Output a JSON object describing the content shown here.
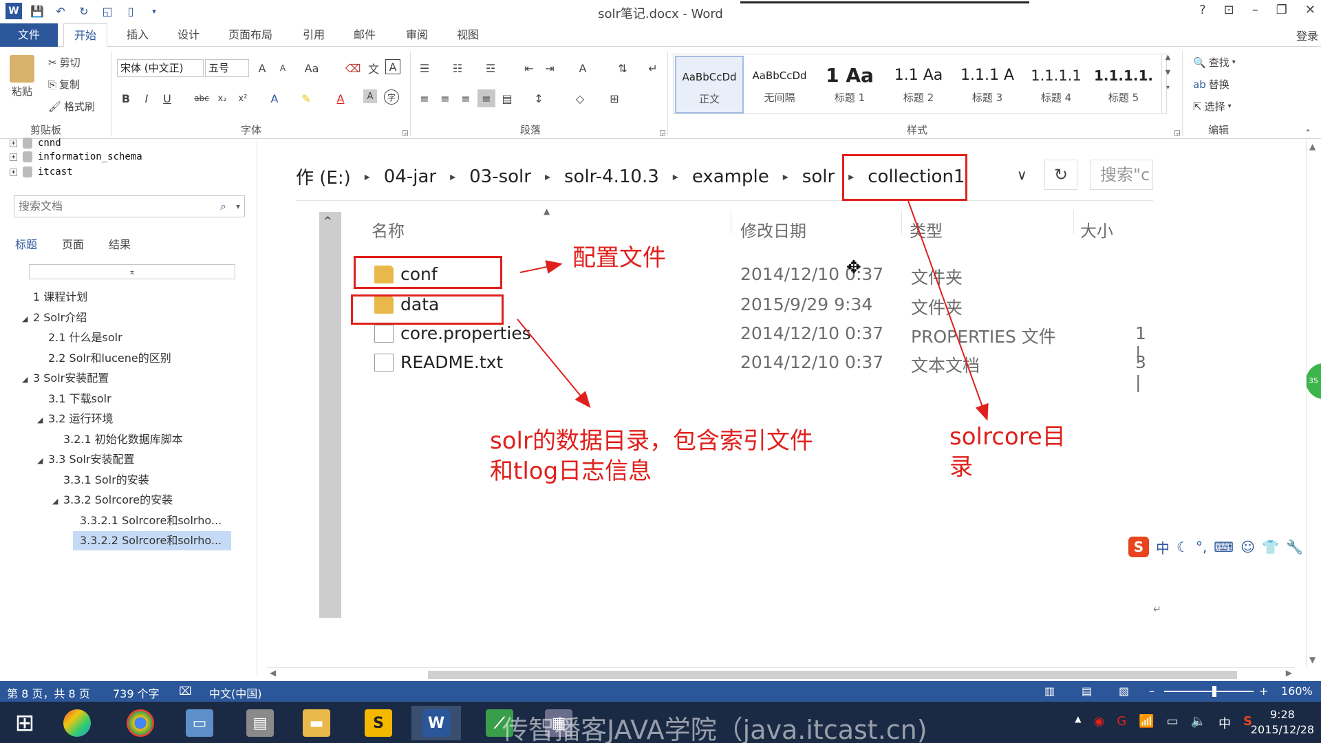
{
  "window": {
    "title": "solr笔记.docx - Word",
    "help": "?",
    "min": "–",
    "restore": "❐",
    "close": "✕"
  },
  "tabs": [
    "文件",
    "开始",
    "插入",
    "设计",
    "页面布局",
    "引用",
    "邮件",
    "审阅",
    "视图"
  ],
  "login": "登录",
  "ribbon": {
    "clipboard": {
      "paste": "粘贴",
      "cut": "剪切",
      "copy": "复制",
      "format_painter": "格式刷",
      "label": "剪贴板"
    },
    "font": {
      "name": "宋体 (中文正)",
      "size": "五号",
      "label": "字体",
      "bold": "B",
      "italic": "I",
      "underline": "U",
      "strike": "abc",
      "sub": "x₂",
      "sup": "x²",
      "case": "Aa",
      "grow": "A",
      "shrink": "A"
    },
    "paragraph": {
      "label": "段落"
    },
    "styles": {
      "label": "样式",
      "items": [
        {
          "sample": "AaBbCcDd",
          "name": "正文"
        },
        {
          "sample": "AaBbCcDd",
          "name": "无间隔"
        },
        {
          "sample": "1 Aa",
          "name": "标题 1"
        },
        {
          "sample": "1.1 Aa",
          "name": "标题 2"
        },
        {
          "sample": "1.1.1 A",
          "name": "标题 3"
        },
        {
          "sample": "1.1.1.1",
          "name": "标题 4"
        },
        {
          "sample": "1.1.1.1.",
          "name": "标题 5"
        }
      ]
    },
    "editing": {
      "find": "查找",
      "replace": "替换",
      "select": "选择",
      "label": "编辑"
    }
  },
  "nav": {
    "db_items": [
      "cnnd",
      "information_schema",
      "itcast"
    ],
    "search_placeholder": "搜索文档",
    "tabs": [
      "标题",
      "页面",
      "结果"
    ],
    "headings": [
      {
        "text": "1 课程计划",
        "level": 1,
        "expand": ""
      },
      {
        "text": "2 Solr介绍",
        "level": 1,
        "expand": "◢"
      },
      {
        "text": "2.1 什么是solr",
        "level": 2,
        "expand": ""
      },
      {
        "text": "2.2 Solr和lucene的区别",
        "level": 2,
        "expand": ""
      },
      {
        "text": "3 Solr安装配置",
        "level": 1,
        "expand": "◢"
      },
      {
        "text": "3.1 下载solr",
        "level": 2,
        "expand": ""
      },
      {
        "text": "3.2 运行环境",
        "level": 2,
        "expand": "◢"
      },
      {
        "text": "3.2.1 初始化数据库脚本",
        "level": 3,
        "expand": ""
      },
      {
        "text": "3.3 Solr安装配置",
        "level": 2,
        "expand": "◢"
      },
      {
        "text": "3.3.1 Solr的安装",
        "level": 3,
        "expand": ""
      },
      {
        "text": "3.3.2 Solrcore的安装",
        "level": 3,
        "expand": "◢"
      },
      {
        "text": "3.3.2.1 Solrcore和solrho...",
        "level": 4,
        "expand": ""
      },
      {
        "text": "3.3.2.2 Solrcore和solrho...",
        "level": 4,
        "expand": "",
        "selected": true
      }
    ]
  },
  "explorer": {
    "breadcrumbs": [
      "作 (E:)",
      "04-jar",
      "03-solr",
      "solr-4.10.3",
      "example",
      "solr",
      "collection1"
    ],
    "search_placeholder": "搜索\"c",
    "columns": {
      "name": "名称",
      "date": "修改日期",
      "type": "类型",
      "size": "大小"
    },
    "files": [
      {
        "name": "conf",
        "date": "2014/12/10 0:37",
        "type": "文件夹",
        "size": "",
        "icon": "folder-icon"
      },
      {
        "name": "data",
        "date": "2015/9/29 9:34",
        "type": "文件夹",
        "size": "",
        "icon": "folder-icon"
      },
      {
        "name": "core.properties",
        "date": "2014/12/10 0:37",
        "type": "PROPERTIES 文件",
        "size": "1 |",
        "icon": "file-icon"
      },
      {
        "name": "README.txt",
        "date": "2014/12/10 0:37",
        "type": "文本文档",
        "size": "3 |",
        "icon": "text-file-icon"
      }
    ]
  },
  "annotations": {
    "config": "配置文件",
    "data_line1": "solr的数据目录，包含索引文件",
    "data_line2": "和tlog日志信息",
    "core_line1": "solrcore目",
    "core_line2": "录"
  },
  "status": {
    "page": "第 8 页，共 8 页",
    "words": "739 个字",
    "lang": "中文(中国)",
    "zoom": "160%"
  },
  "ime": {
    "lang": "中"
  },
  "taskbar": {
    "watermark": "传智播客JAVA学院（java.itcast.cn)",
    "time": "9:28",
    "date": "2015/12/28",
    "tray_lang": "中"
  },
  "colors": {
    "accent": "#2b579a",
    "annotation": "#e0201c"
  }
}
